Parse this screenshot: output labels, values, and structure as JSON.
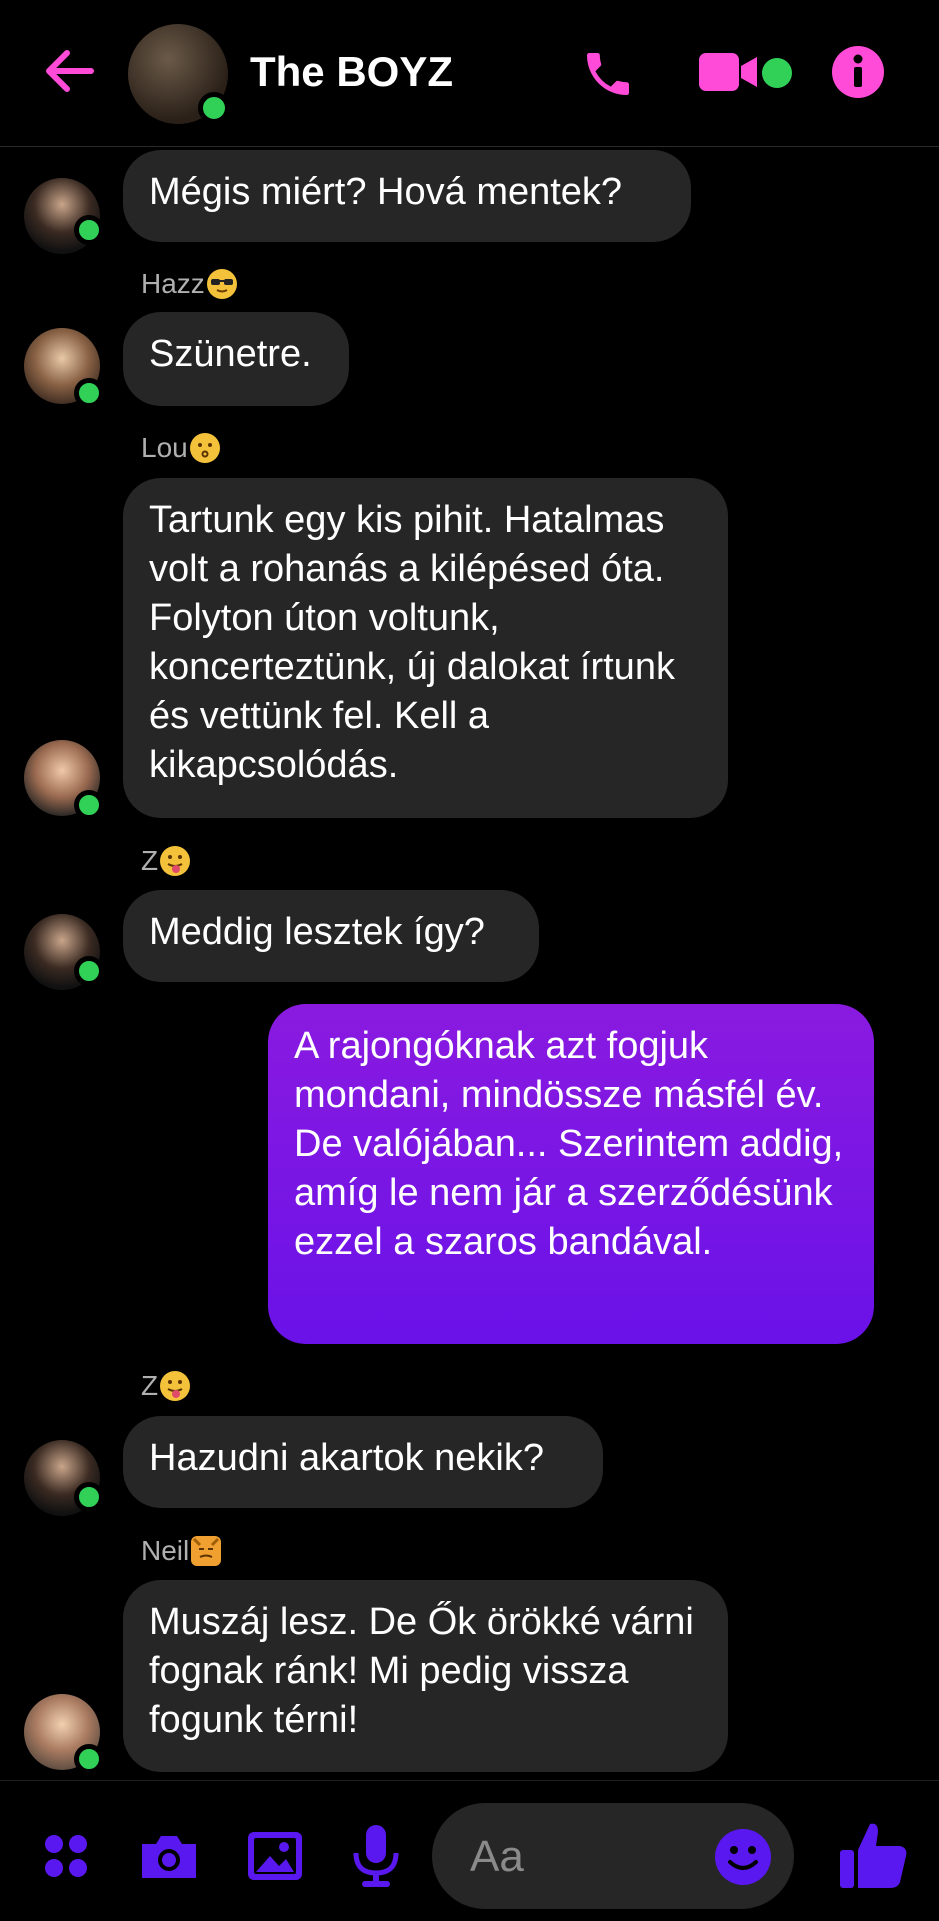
{
  "header": {
    "title": "The BOYZ",
    "back_icon": "back-arrow-icon",
    "call_icon": "phone-icon",
    "video_icon": "video-camera-icon",
    "info_icon": "info-icon"
  },
  "colors": {
    "accent": "#ff4bd8",
    "composer_icons": "#5a18f0",
    "my_bubble": "#7b16e6",
    "their_bubble": "#262626",
    "online": "#31d158"
  },
  "messages": [
    {
      "sender": "",
      "text": "Mégis miért? Hová mentek?"
    },
    {
      "sender": "Hazz",
      "sender_emoji": "😎",
      "text": "Szünetre."
    },
    {
      "sender": "Lou",
      "sender_emoji": "😗",
      "text": "Tartunk egy kis pihit. Hatalmas volt a rohanás a kilépésed óta. Folyton úton voltunk, koncerteztünk, új dalokat írtunk és vettünk fel. Kell a kikapcsolódás."
    },
    {
      "sender": "Z",
      "sender_emoji": "😛",
      "text": "Meddig lesztek így?"
    },
    {
      "sender": "me",
      "text": "A rajongóknak azt fogjuk mondani, mindössze másfél év. De valójában... Szerintem addig, amíg le nem jár a szerződésünk ezzel a szaros bandával."
    },
    {
      "sender": "Z",
      "sender_emoji": "😛",
      "text": "Hazudni akartok nekik?"
    },
    {
      "sender": "Neil",
      "sender_emoji": "😼",
      "text": "Muszáj lesz. De Ők örökké várni fognak ránk! Mi pedig vissza fogunk térni!"
    }
  ],
  "composer": {
    "placeholder": "Aa",
    "icons": [
      "apps-icon",
      "camera-icon",
      "gallery-icon",
      "microphone-icon",
      "emoji-icon",
      "thumbs-up-icon"
    ]
  }
}
